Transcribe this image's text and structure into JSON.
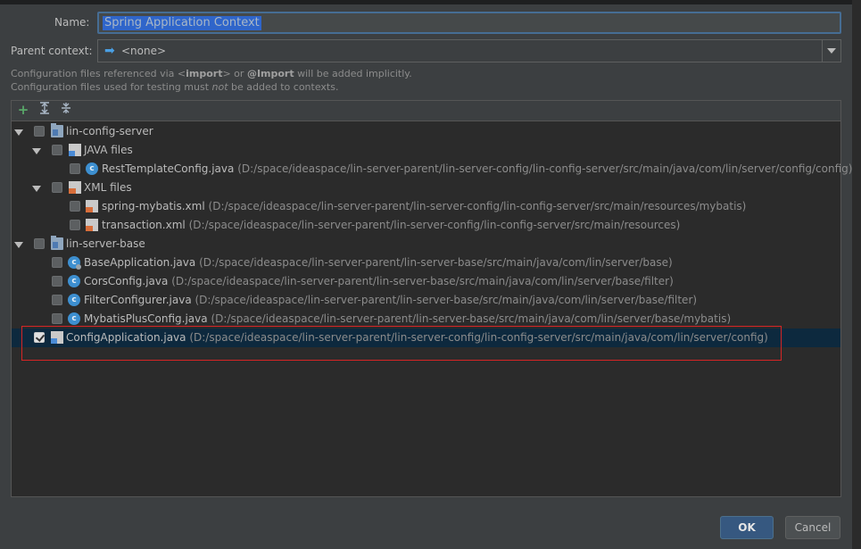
{
  "form": {
    "name_label": "Name:",
    "name_value": "Spring Application Context",
    "parent_label": "Parent context:",
    "parent_value": "<none>"
  },
  "hints": {
    "line1_pre": "Configuration files referenced via <",
    "line1_import": "import",
    "line1_mid": "> or ",
    "line1_at_import": "@Import",
    "line1_post": " will be added implicitly.",
    "line2_pre": "Configuration files used for testing must ",
    "line2_not": "not",
    "line2_post": " be added to contexts."
  },
  "toolbar": {
    "add_icon": "plus-icon",
    "expand_icon": "expand-all-icon",
    "collapse_icon": "collapse-all-icon"
  },
  "tree": {
    "rows": [
      {
        "name": "lin-config-server",
        "path": ""
      },
      {
        "name": "JAVA files",
        "path": ""
      },
      {
        "name": "RestTemplateConfig.java",
        "path": "(D:/space/ideaspace/lin-server-parent/lin-server-config/lin-config-server/src/main/java/com/lin/server/config/config)"
      },
      {
        "name": "XML files",
        "path": ""
      },
      {
        "name": "spring-mybatis.xml",
        "path": "(D:/space/ideaspace/lin-server-parent/lin-server-config/lin-config-server/src/main/resources/mybatis)"
      },
      {
        "name": "transaction.xml",
        "path": "(D:/space/ideaspace/lin-server-parent/lin-server-config/lin-config-server/src/main/resources)"
      },
      {
        "name": "lin-server-base",
        "path": ""
      },
      {
        "name": "BaseApplication.java",
        "path": "(D:/space/ideaspace/lin-server-parent/lin-server-base/src/main/java/com/lin/server/base)"
      },
      {
        "name": "CorsConfig.java",
        "path": "(D:/space/ideaspace/lin-server-parent/lin-server-base/src/main/java/com/lin/server/base/filter)"
      },
      {
        "name": "FilterConfigurer.java",
        "path": "(D:/space/ideaspace/lin-server-parent/lin-server-base/src/main/java/com/lin/server/base/filter)"
      },
      {
        "name": "MybatisPlusConfig.java",
        "path": "(D:/space/ideaspace/lin-server-parent/lin-server-base/src/main/java/com/lin/server/base/mybatis)"
      },
      {
        "name": "ConfigApplication.java",
        "path": "(D:/space/ideaspace/lin-server-parent/lin-server-config/lin-config-server/src/main/java/com/lin/server/config)"
      }
    ]
  },
  "buttons": {
    "ok": "OK",
    "cancel": "Cancel"
  },
  "colors": {
    "background": "#3c3f41",
    "panel": "#2b2b2b",
    "selection": "#0d293e",
    "highlight_box": "#d62525",
    "ok_button": "#365880"
  }
}
